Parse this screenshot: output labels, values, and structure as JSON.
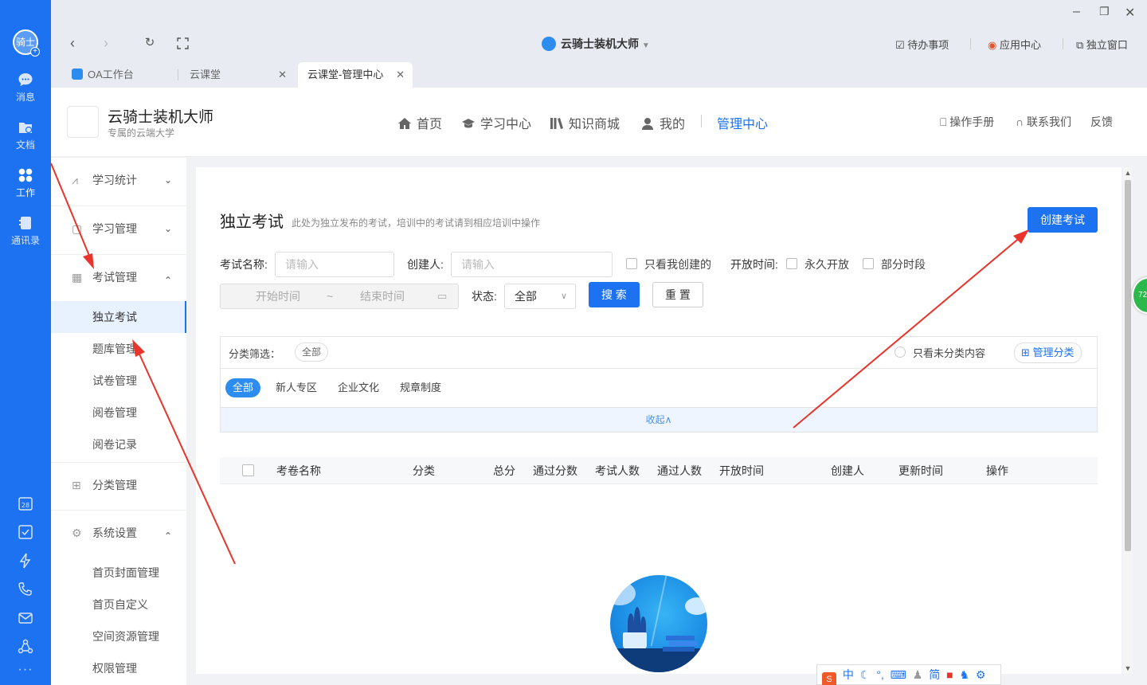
{
  "rail": {
    "avatar_text": "骑士",
    "items": [
      {
        "label": "消息",
        "icon": "message-icon"
      },
      {
        "label": "文档",
        "icon": "document-icon"
      },
      {
        "label": "工作",
        "icon": "work-icon"
      },
      {
        "label": "通讯录",
        "icon": "contacts-icon"
      }
    ],
    "calendar_day": "28",
    "more": "···"
  },
  "titlebar": {
    "app_title": "云骑士装机大师",
    "todo": "待办事项",
    "app_center": "应用中心",
    "standalone": "独立窗口"
  },
  "tabs": [
    {
      "label": "OA工作台"
    },
    {
      "label": "云课堂"
    },
    {
      "label": "云课堂-管理中心"
    }
  ],
  "site": {
    "name": "云骑士装机大师",
    "subtitle": "专属的云端大学",
    "nav": [
      "首页",
      "学习中心",
      "知识商城",
      "我的",
      "管理中心"
    ],
    "manual": "操作手册",
    "contact": "联系我们",
    "feedback": "反馈"
  },
  "sidebar": {
    "groups": [
      {
        "label": "学习统计",
        "chev": "⌄"
      },
      {
        "label": "学习管理",
        "chev": "⌄"
      },
      {
        "label": "考试管理",
        "chev": "⌃"
      },
      {
        "label": "分类管理",
        "chev": ""
      },
      {
        "label": "系统设置",
        "chev": "⌃"
      }
    ],
    "exam_items": [
      "独立考试",
      "题库管理",
      "试卷管理",
      "阅卷管理",
      "阅卷记录"
    ],
    "system_items": [
      "首页封面管理",
      "首页自定义",
      "空间资源管理",
      "权限管理"
    ]
  },
  "main": {
    "title": "独立考试",
    "desc": "此处为独立发布的考试，培训中的考试请到相应培训中操作",
    "create_btn": "创建考试",
    "filters": {
      "exam_name_label": "考试名称:",
      "exam_name_placeholder": "请输入",
      "creator_label": "创建人:",
      "creator_placeholder": "请输入",
      "only_mine": "只看我创建的",
      "open_time_label": "开放时间:",
      "forever_open": "永久开放",
      "partial_period": "部分时段",
      "start_time": "开始时间",
      "range_sep": "~",
      "end_time": "结束时间",
      "status_label": "状态:",
      "status_value": "全部",
      "search_btn": "搜 索",
      "reset_btn": "重 置"
    },
    "category": {
      "filter_label": "分类筛选：",
      "current": "全部",
      "only_uncategorized": "只看未分类内容",
      "manage_btn": "管理分类",
      "chips": [
        "全部",
        "新人专区",
        "企业文化",
        "规章制度"
      ],
      "collapse": "收起∧"
    },
    "table_headers": [
      "考卷名称",
      "分类",
      "总分",
      "通过分数",
      "考试人数",
      "通过人数",
      "开放时间",
      "创建人",
      "更新时间",
      "操作"
    ]
  },
  "float_badge": "72",
  "ime": {
    "items": [
      "中",
      "简"
    ]
  }
}
